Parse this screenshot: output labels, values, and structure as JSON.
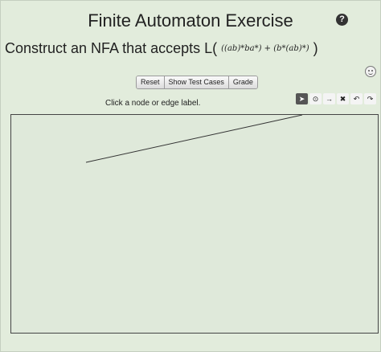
{
  "title": "Finite Automaton Exercise",
  "help_glyph": "?",
  "prompt": {
    "text": "Construct an NFA that accepts L(",
    "expression": "((ab)*ba*) + (b*(ab)*)",
    "close": ")"
  },
  "buttons": {
    "reset": "Reset",
    "show_test_cases": "Show Test Cases",
    "grade": "Grade"
  },
  "status": "Click a node or edge label.",
  "tools": {
    "select": "➤",
    "add_node": "⊙",
    "add_edge": "→",
    "delete": "✖",
    "undo": "↶",
    "redo": "↷"
  },
  "face_icon": "smiley-icon"
}
